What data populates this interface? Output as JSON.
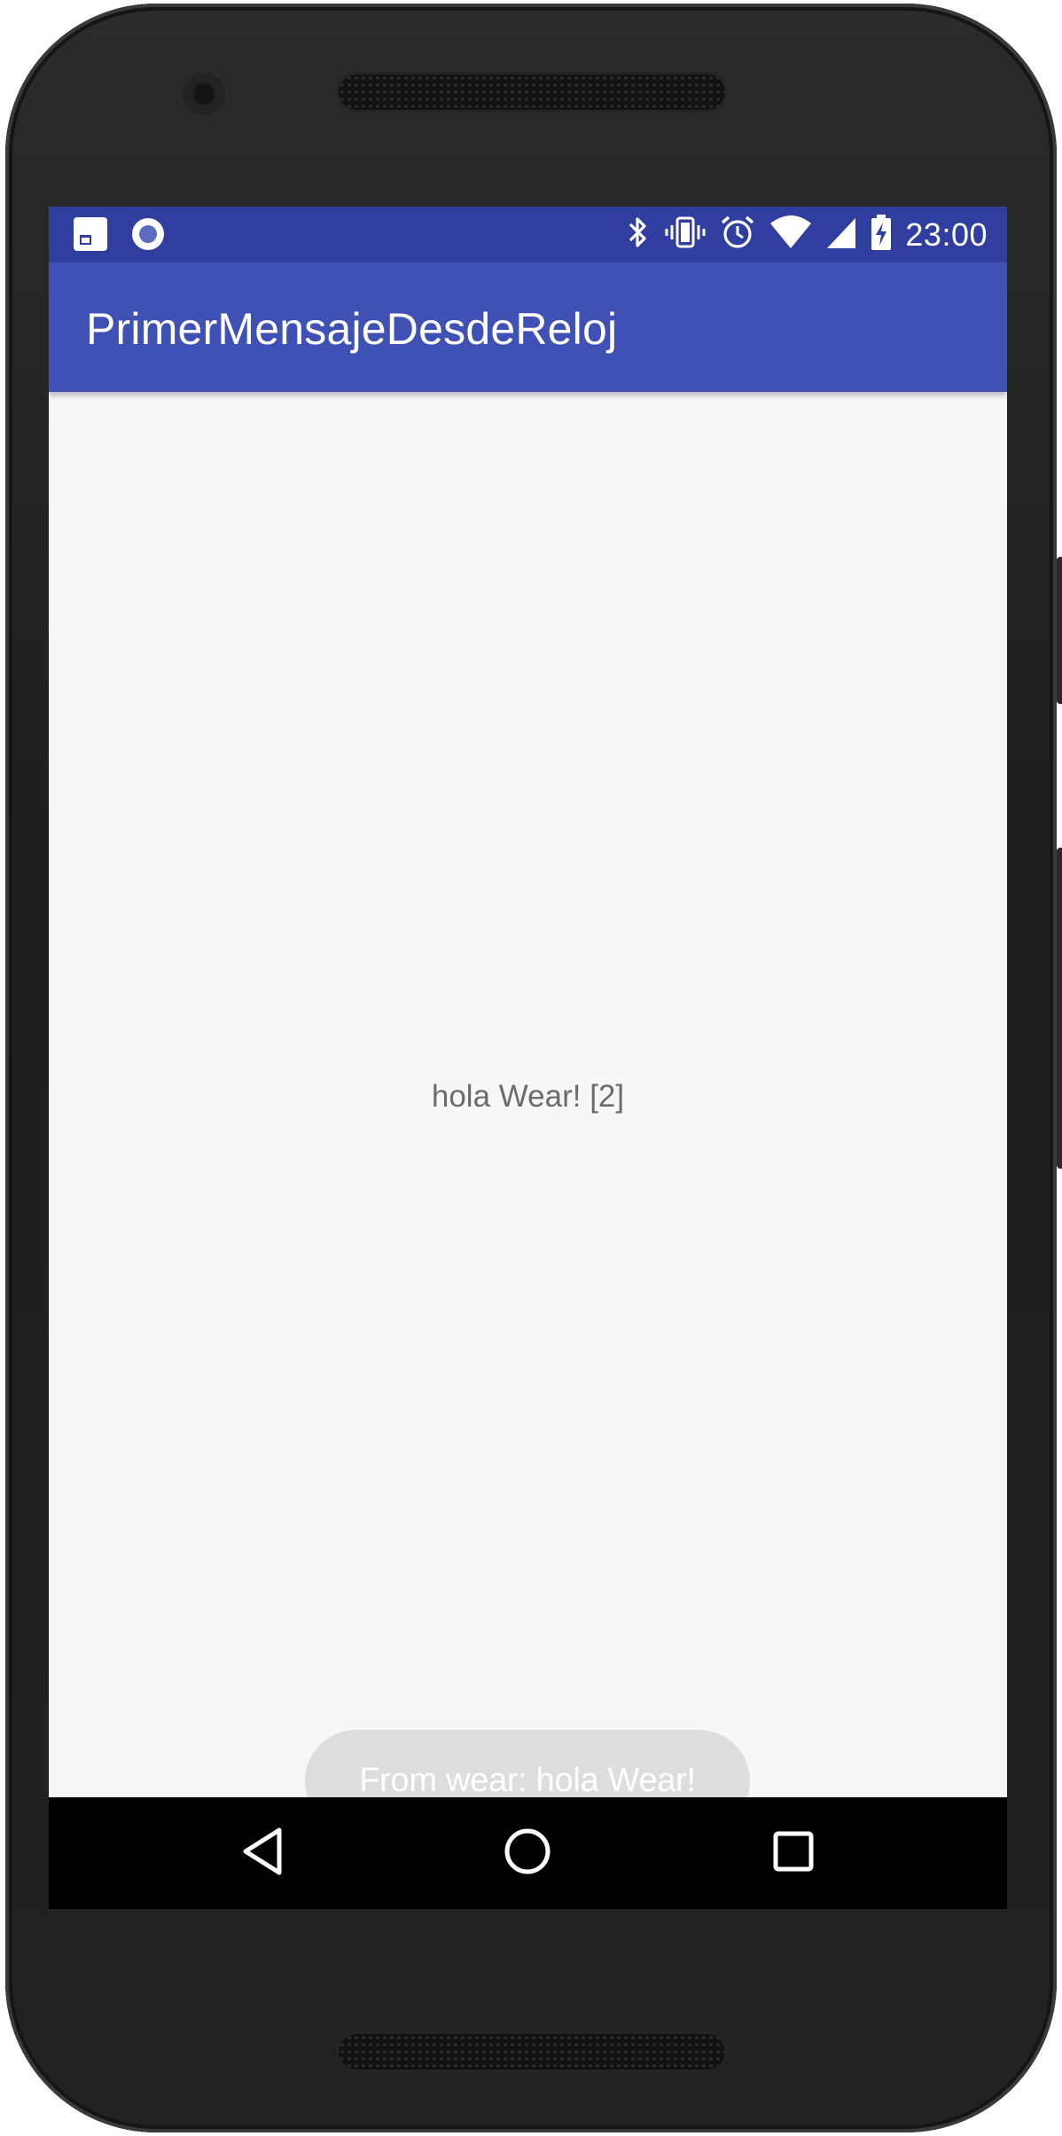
{
  "status_bar": {
    "left_icons": [
      "sim-card-icon",
      "record-icon"
    ],
    "right_icons": [
      "bluetooth-icon",
      "vibrate-icon",
      "alarm-icon",
      "wifi-icon",
      "cell-signal-icon",
      "battery-charging-icon"
    ],
    "time": "23:00",
    "color": "#303f9f"
  },
  "app_bar": {
    "title": "PrimerMensajeDesdeReloj",
    "color": "#3f51b5"
  },
  "main": {
    "message": "hola Wear! [2]",
    "background": "#f7f7f7"
  },
  "toast": {
    "text": "From wear: hola Wear!"
  },
  "nav_bar": {
    "buttons": [
      "back-icon",
      "home-icon",
      "recents-icon"
    ]
  }
}
